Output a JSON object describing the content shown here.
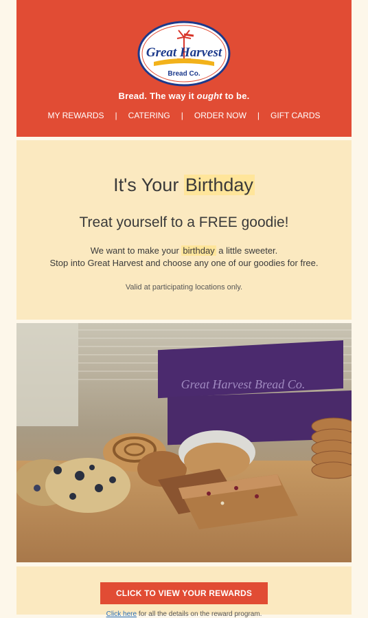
{
  "brand": {
    "logo_line1": "Great Harvest",
    "logo_line2": "Bread Co.",
    "tagline_part1": "Bread. The way it ",
    "tagline_emph": "ought",
    "tagline_part2": " to be."
  },
  "nav": {
    "items": [
      "MY REWARDS",
      "CATERING",
      "ORDER NOW",
      "GIFT CARDS"
    ],
    "separator": "|"
  },
  "intro": {
    "title_prefix": "It's Your ",
    "title_highlight": "Birthday",
    "subtitle": "Treat yourself to a FREE goodie!",
    "line1_prefix": "We want to make your ",
    "line1_highlight": "birthday",
    "line1_suffix": " a little sweeter.",
    "line2": "Stop into Great Harvest and choose any one of our goodies for free.",
    "fine_print": "Valid at participating locations only."
  },
  "photo": {
    "box_text": "Great Harvest Bread Co."
  },
  "cta": {
    "button_label": "CLICK TO VIEW YOUR REWARDS",
    "footer_link": "Click here",
    "footer_text": " for all the details on the reward program."
  },
  "colors": {
    "brand_red": "#e14c34",
    "cream": "#fbe9c0",
    "highlight": "#ffe59a"
  }
}
